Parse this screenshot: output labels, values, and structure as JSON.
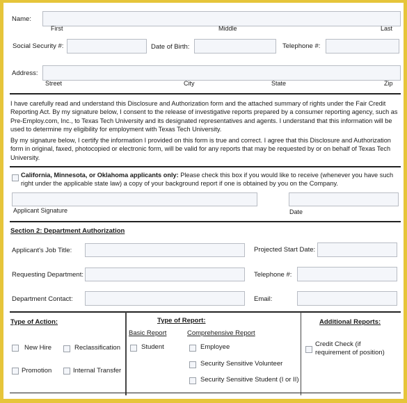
{
  "colors": {
    "frame": "#e6c53a",
    "field_bg": "#f4f6fa",
    "field_border": "#b8bcc4"
  },
  "section1": {
    "name_label": "Name:",
    "name_sublabels": [
      "First",
      "Middle",
      "Last"
    ],
    "ssn_label": "Social Security #:",
    "dob_label": "Date of Birth:",
    "phone_label": "Telephone #:",
    "address_label": "Address:",
    "address_sublabels": [
      "Street",
      "City",
      "State",
      "Zip"
    ],
    "fields": {
      "name": "",
      "ssn": "",
      "dob": "",
      "phone": "",
      "address": ""
    }
  },
  "disclosure": {
    "paragraph1": "I have carefully read and understand this Disclosure and Authorization form and the attached summary of rights under the Fair Credit Reporting Act. By my signature below, I consent to the release of investigative reports prepared by a consumer reporting agency, such as Pre-Employ.com, Inc., to Texas Tech University and its designated representatives and agents. I understand that this information will be used to determine my eligibility for employment with Texas Tech University.",
    "paragraph2": "By my signature below, I certify the information I provided on this form is true and correct. I agree that this Disclosure and Authorization form in original, faxed, photocopied or electronic form, will be valid for any reports that may be requested by or on behalf of Texas Tech University."
  },
  "state_notice": {
    "bold": "California, Minnesota, or Oklahoma applicants only:",
    "text": " Please check this box if you would like to receive (whenever you have such right under the applicable state law) a copy of your background report if one is obtained by you on the Company.",
    "checked": false
  },
  "signature": {
    "signature_label": "Applicant Signature",
    "date_label": "Date",
    "signature_value": "",
    "date_value": ""
  },
  "section2": {
    "title": "Section 2: Department Authorization",
    "job_title_label": "Applicant's Job Title:",
    "start_date_label": "Projected Start Date:",
    "dept_label": "Requesting Department:",
    "phone_label": "Telephone #:",
    "contact_label": "Department Contact:",
    "email_label": "Email:",
    "fields": {
      "job_title": "",
      "start_date": "",
      "dept": "",
      "phone": "",
      "contact": "",
      "email": ""
    }
  },
  "type_of_action": {
    "title": "Type of Action:",
    "options": [
      {
        "label": "New Hire",
        "checked": false
      },
      {
        "label": "Reclassification",
        "checked": false
      },
      {
        "label": "Promotion",
        "checked": false
      },
      {
        "label": "Internal Transfer",
        "checked": false
      }
    ]
  },
  "type_of_report": {
    "title": "Type of Report:",
    "basic_title": "Basic Report",
    "basic_options": [
      {
        "label": "Student",
        "checked": false
      }
    ],
    "comprehensive_title": "Comprehensive Report",
    "comprehensive_options": [
      {
        "label": "Employee",
        "checked": false
      },
      {
        "label": "Security Sensitive Volunteer",
        "checked": false
      },
      {
        "label": "Security Sensitive Student (I or II)",
        "checked": false
      }
    ]
  },
  "additional_reports": {
    "title": "Additional Reports:",
    "options": [
      {
        "label": "Credit Check (if requirement of position)",
        "line1": "Credit Check (if",
        "line2": "requirement of position)",
        "checked": false
      }
    ]
  }
}
